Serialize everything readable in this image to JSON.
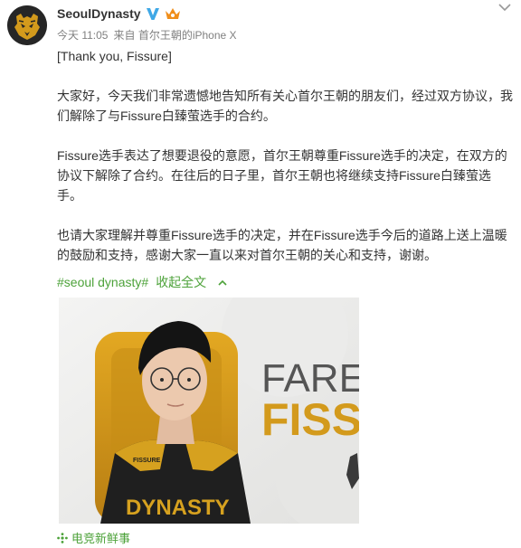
{
  "header": {
    "username": "SeoulDynasty",
    "time": "今天 11:05",
    "source": "来自 首尔王朝的iPhone X"
  },
  "post": {
    "paragraphs": [
      "[Thank you, Fissure]",
      "大家好，今天我们非常遗憾地告知所有关心首尔王朝的朋友们，经过双方协议，我们解除了与Fissure白臻萤选手的合约。",
      "Fissure选手表达了想要退役的意愿，首尔王朝尊重Fissure选手的决定，在双方的协议下解除了合约。在往后的日子里，首尔王朝也将继续支持Fissure白臻萤选手。",
      "也请大家理解并尊重Fissure选手的决定，并在Fissure选手今后的道路上送上温暖的鼓励和支持，感谢大家一直以来对首尔王朝的关心和支持，谢谢。"
    ],
    "hashtag": "#seoul dynasty#",
    "collapse_label": "收起全文"
  },
  "image": {
    "headline_top": "FARE",
    "headline_bottom": "FISS",
    "jersey_text": "DYNASTY",
    "chest_text": "FISSURE"
  },
  "footer": {
    "source_label": "电竞新鲜事"
  },
  "colors": {
    "link_green": "#4da23a",
    "meta_gray": "#808080",
    "text_dark": "#333333",
    "brand_gold": "#d39a1c",
    "verified_blue": "#3fa8e6",
    "vip_orange": "#f08e1a"
  },
  "icons": {
    "avatar": "seoul-dynasty-tiger-logo",
    "verified": "verified-v-icon",
    "vip": "vip-crown-icon",
    "menu": "chevron-down-icon",
    "collapse": "chevron-up-icon",
    "source": "sparkle-icon"
  }
}
